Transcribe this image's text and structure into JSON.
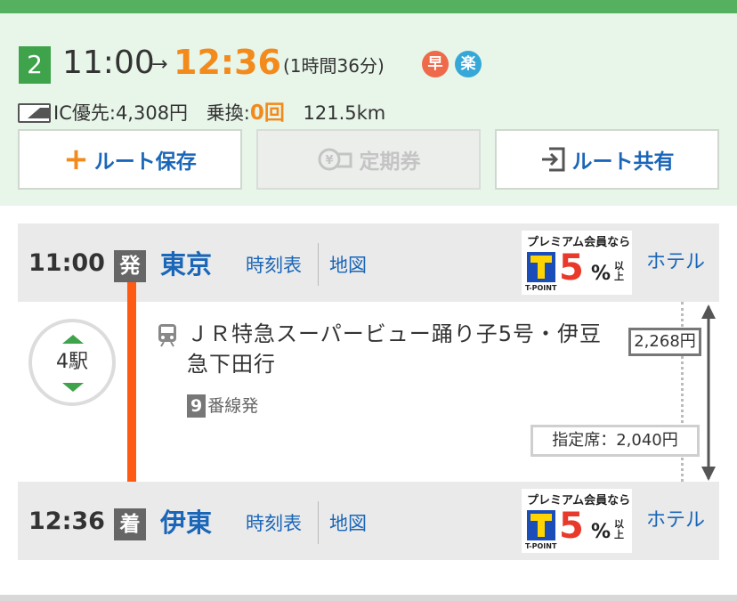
{
  "route": {
    "number": "2",
    "departure_time": "11:00",
    "arrow": "→",
    "arrival_time": "12:36",
    "duration": "(1時間36分)",
    "badge_fast": "早",
    "badge_easy": "楽",
    "fare_prefix": "IC優先:",
    "fare_amount": "4,308円",
    "transfer_label": "乗換:",
    "transfer_count": "0回",
    "distance": "121.5km"
  },
  "actions": {
    "save": "ルート保存",
    "pass": "定期券",
    "share": "ルート共有"
  },
  "departure": {
    "time": "11:00",
    "tag": "発",
    "station": "東京",
    "timetable": "時刻表",
    "map": "地図",
    "hotel": "ホテル"
  },
  "arrival": {
    "time": "12:36",
    "tag": "着",
    "station": "伊東",
    "timetable": "時刻表",
    "map": "地図",
    "hotel": "ホテル"
  },
  "promo": {
    "title": "プレミアム会員なら",
    "percent": "5",
    "percent_sign": "%",
    "suffix": "以上",
    "brand": "T-POINT"
  },
  "segment": {
    "stops": "4駅",
    "train_name": "ＪＲ特急スーパービュー踊り子5号・伊豆急下田行",
    "platform_number": "9",
    "platform_text": "番線発",
    "fare": "2,268円",
    "seat_fare": "指定席：2,040円"
  },
  "colors": {
    "accent_orange": "#f28a1c",
    "link_blue": "#1a66b8",
    "brand_green": "#3ea34a",
    "line_orange": "#ff5a14"
  }
}
